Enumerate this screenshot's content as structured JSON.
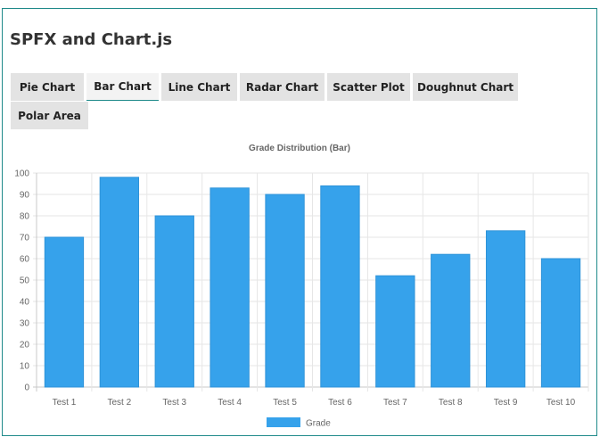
{
  "page": {
    "title": "SPFX and Chart.js"
  },
  "tabs": [
    {
      "label": "Pie Chart",
      "active": false
    },
    {
      "label": "Bar Chart",
      "active": true
    },
    {
      "label": "Line Chart",
      "active": false
    },
    {
      "label": "Radar Chart",
      "active": false
    },
    {
      "label": "Scatter Plot",
      "active": false
    },
    {
      "label": "Doughnut Chart",
      "active": false
    },
    {
      "label": "Polar Area",
      "active": false
    }
  ],
  "chart_data": {
    "type": "bar",
    "title": "Grade Distribution (Bar)",
    "categories": [
      "Test 1",
      "Test 2",
      "Test 3",
      "Test 4",
      "Test 5",
      "Test 6",
      "Test 7",
      "Test 8",
      "Test 9",
      "Test 10"
    ],
    "series": [
      {
        "name": "Grade",
        "values": [
          70,
          98,
          80,
          93,
          90,
          94,
          52,
          62,
          73,
          60
        ],
        "color": "#36a2eb"
      }
    ],
    "ylim": [
      0,
      100
    ],
    "yticks": [
      0,
      10,
      20,
      30,
      40,
      50,
      60,
      70,
      80,
      90,
      100
    ],
    "grid": true,
    "legend_position": "bottom"
  }
}
